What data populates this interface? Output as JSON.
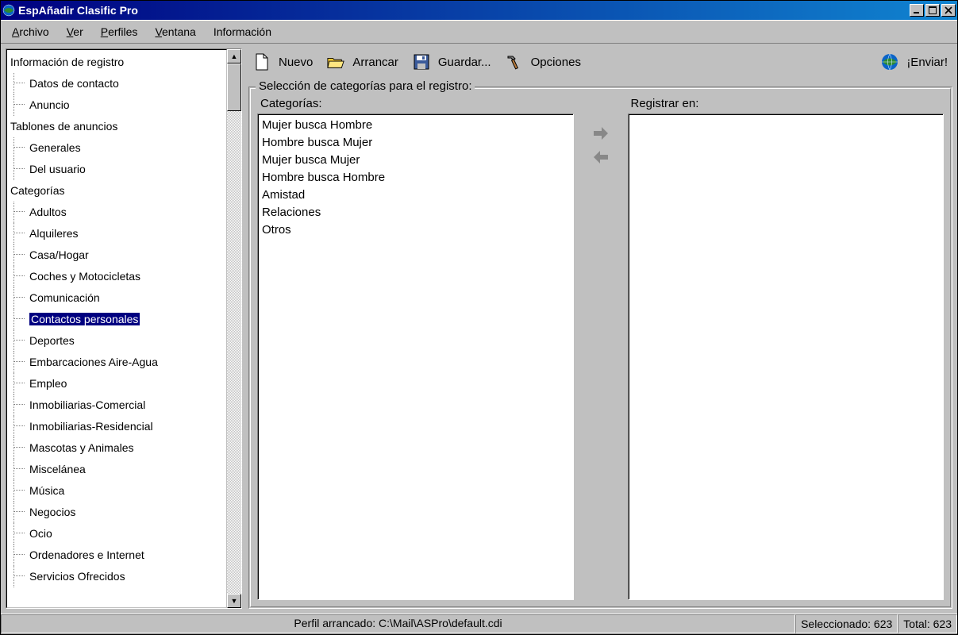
{
  "titlebar": {
    "title": "EspAñadir Clasific Pro"
  },
  "menu": {
    "archivo": "Archivo",
    "ver": "Ver",
    "perfiles": "Perfiles",
    "ventana": "Ventana",
    "info": "Información"
  },
  "tree": {
    "root_registro": "Información de registro",
    "datos_contacto": "Datos de contacto",
    "anuncio": "Anuncio",
    "root_tablones": "Tablones de anuncios",
    "generales": "Generales",
    "del_usuario": "Del usuario",
    "root_categorias": "Categorías",
    "adultos": "Adultos",
    "alquileres": "Alquileres",
    "casa": "Casa/Hogar",
    "coches": "Coches y Motocicletas",
    "comunicacion": "Comunicación",
    "contactos": "Contactos personales",
    "deportes": "Deportes",
    "embarcaciones": "Embarcaciones Aire-Agua",
    "empleo": "Empleo",
    "inmob_com": "Inmobiliarias-Comercial",
    "inmob_res": "Inmobiliarias-Residencial",
    "mascotas": "Mascotas y Animales",
    "misc": "Miscelánea",
    "musica": "Música",
    "negocios": "Negocios",
    "ocio": "Ocio",
    "ordenadores": "Ordenadores e Internet",
    "servicios": "Servicios Ofrecidos"
  },
  "toolbar": {
    "nuevo": "Nuevo",
    "arrancar": "Arrancar",
    "guardar": "Guardar...",
    "opciones": "Opciones",
    "enviar": "¡Enviar!"
  },
  "group": {
    "title": "Selección de categorías para el registro:",
    "categorias_label": "Categorías:",
    "registrar_label": "Registrar en:",
    "items": {
      "i0": "Mujer busca Hombre",
      "i1": "Hombre busca Mujer",
      "i2": "Mujer busca Mujer",
      "i3": "Hombre busca Hombre",
      "i4": "Amistad",
      "i5": "Relaciones",
      "i6": "Otros"
    }
  },
  "status": {
    "path": "Perfil arrancado: C:\\Mail\\ASPro\\default.cdi",
    "seleccionado": "Seleccionado: 623",
    "total": "Total: 623"
  }
}
